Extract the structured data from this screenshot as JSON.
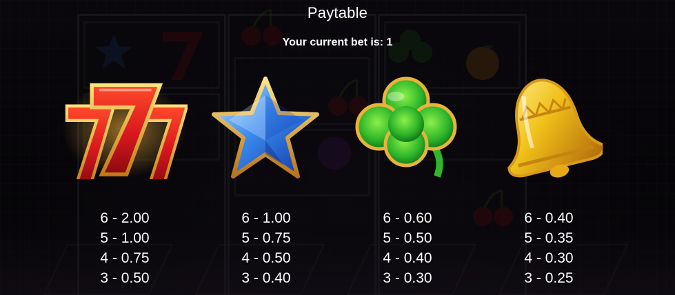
{
  "header": {
    "title": "Paytable",
    "bet_prefix": "Your current bet is:",
    "bet_value": "1"
  },
  "symbols": [
    {
      "name": "triple-seven",
      "icon": "seven-icon",
      "payouts": [
        "6 - 2.00",
        "5 - 1.00",
        "4 - 0.75",
        "3 - 0.50"
      ]
    },
    {
      "name": "star",
      "icon": "star-icon",
      "payouts": [
        "6 - 1.00",
        "5 - 0.75",
        "4 - 0.50",
        "3 - 0.40"
      ]
    },
    {
      "name": "clover",
      "icon": "clover-icon",
      "payouts": [
        "6 - 0.60",
        "5 - 0.50",
        "4 - 0.40",
        "3 - 0.30"
      ]
    },
    {
      "name": "bell",
      "icon": "bell-icon",
      "payouts": [
        "6 - 0.40",
        "5 - 0.35",
        "4 - 0.30",
        "3 - 0.25"
      ]
    }
  ],
  "colors": {
    "seven": "#d8171e",
    "star": "#2a6fe0",
    "clover": "#2fb62a",
    "bell": "#f2c21a",
    "gold_rim": "#f3c24a"
  }
}
